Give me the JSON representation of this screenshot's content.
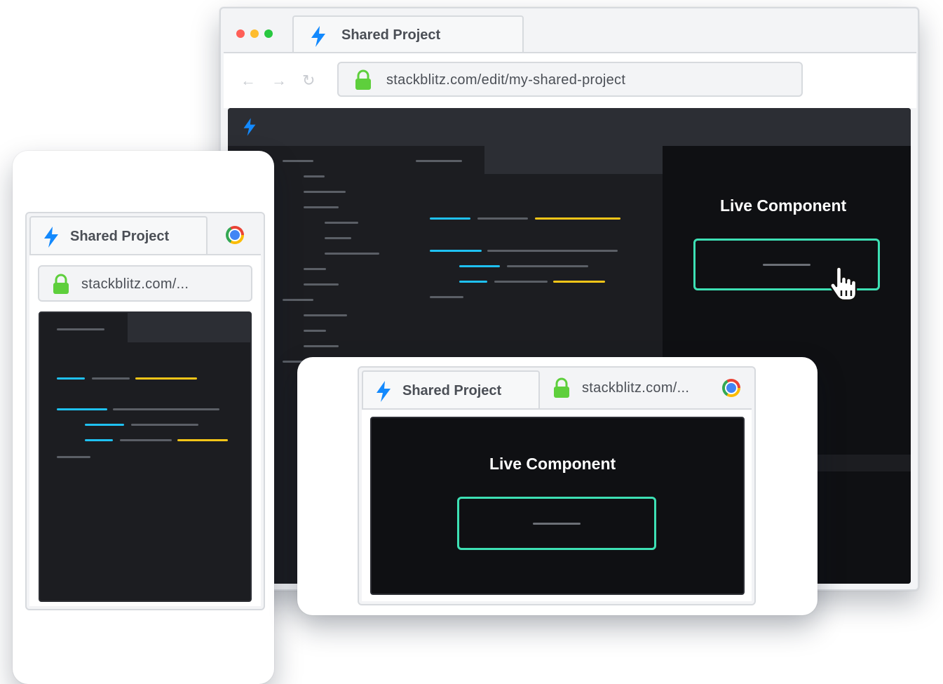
{
  "desktop": {
    "tab_title": "Shared Project",
    "url": "stackblitz.com/edit/my-shared-project",
    "nav": {
      "back": "←",
      "forward": "→",
      "reload": "↻"
    },
    "traffic_light_colors": [
      "#ff5f57",
      "#febc2e",
      "#28c840"
    ],
    "preview": {
      "title": "Live Component"
    }
  },
  "phone": {
    "tab_title": "Shared Project",
    "url": "stackblitz.com/..."
  },
  "tablet": {
    "tab_title": "Shared Project",
    "url": "stackblitz.com/...",
    "preview": {
      "title": "Live Component"
    }
  },
  "colors": {
    "accent_blue": "#1fc1f2",
    "accent_yellow": "#f5c518",
    "preview_button_border": "#3de0b4",
    "lock_green": "#5ecf3c",
    "bolt_blue": "#1389fd"
  },
  "icons": [
    "bolt-icon",
    "lock-icon",
    "chrome-icon",
    "back-arrow-icon",
    "forward-arrow-icon",
    "reload-icon",
    "pointer-hand-icon"
  ]
}
